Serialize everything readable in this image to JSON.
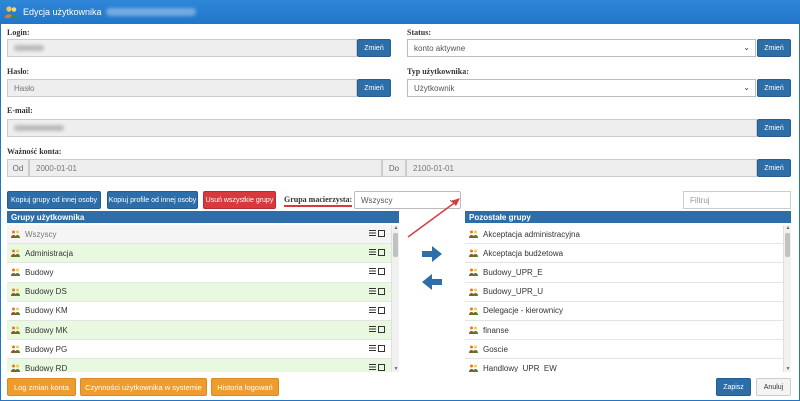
{
  "window": {
    "title": "Edycja użytkownika"
  },
  "form": {
    "login": {
      "label": "Login:",
      "button": "Zmień"
    },
    "status": {
      "label": "Status:",
      "value": "konto aktywne",
      "button": "Zmień"
    },
    "password": {
      "label": "Hasło:",
      "placeholder": "Hasło",
      "button": "Zmień"
    },
    "user_type": {
      "label": "Typ użytkownika:",
      "value": "Użytkownik",
      "button": "Zmień"
    },
    "email": {
      "label": "E-mail:",
      "button": "Zmień"
    },
    "validity": {
      "label": "Ważność konta:",
      "from_label": "Od",
      "from_value": "2000-01-01",
      "to_label": "Do",
      "to_value": "2100-01-01",
      "button": "Zmień"
    }
  },
  "toolbar": {
    "copy_groups": "Kopiuj grupy od innej osoby",
    "copy_profile": "Kopiuj profile od innej osoby",
    "remove_all": "Usuń wszystkie grupy",
    "parent_group_label": "Grupa macierzysta:",
    "parent_group_value": "Wszyscy",
    "filter_placeholder": "Filtruj"
  },
  "user_groups": {
    "header": "Grupy użytkownika",
    "items": [
      {
        "label": "Wszyscy",
        "style": "gray"
      },
      {
        "label": "Administracja",
        "style": "green"
      },
      {
        "label": "Budowy",
        "style": "white"
      },
      {
        "label": "Budowy DS",
        "style": "green"
      },
      {
        "label": "Budowy KM",
        "style": "white"
      },
      {
        "label": "Budowy MK",
        "style": "green"
      },
      {
        "label": "Budowy PG",
        "style": "white"
      },
      {
        "label": "Budowy RD",
        "style": "green"
      }
    ]
  },
  "other_groups": {
    "header": "Pozostałe grupy",
    "items": [
      {
        "label": "Akceptacja administracyjna"
      },
      {
        "label": "Akceptacja budżetowa"
      },
      {
        "label": "Budowy_UPR_E"
      },
      {
        "label": "Budowy_UPR_U"
      },
      {
        "label": "Delegacje - kierownicy"
      },
      {
        "label": "finanse"
      },
      {
        "label": "Goscie"
      },
      {
        "label": "Handlowy_UPR_EW"
      }
    ]
  },
  "footer": {
    "log_changes": "Log zmian konta",
    "user_actions": "Czynności użytkownika w systemie",
    "login_history": "Historia logowań",
    "save": "Zapisz",
    "cancel": "Anuluj"
  },
  "colors": {
    "accent": "#2d6ea8",
    "title_bar": "#2176c8",
    "danger": "#d9393c",
    "warning": "#ef9c2f",
    "row_green": "#e9f9e0"
  }
}
